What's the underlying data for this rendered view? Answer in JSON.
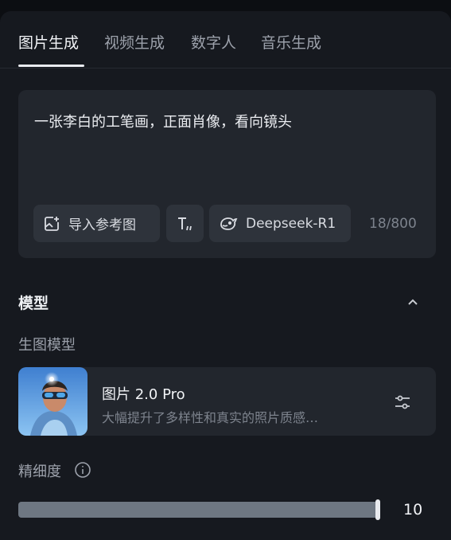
{
  "tabs": [
    {
      "label": "图片生成",
      "active": true
    },
    {
      "label": "视频生成",
      "active": false
    },
    {
      "label": "数字人",
      "active": false
    },
    {
      "label": "音乐生成",
      "active": false
    }
  ],
  "prompt": {
    "text": "一张李白的工笔画，正面肖像，看向镜头",
    "counter": "18/800",
    "chips": {
      "import_ref": {
        "label": "导入参考图",
        "icon": "image-add-icon"
      },
      "text_style": {
        "label": "",
        "icon": "text-format-icon"
      },
      "deepseek": {
        "label": "Deepseek-R1",
        "icon": "deepseek-whale-icon"
      }
    }
  },
  "model_section": {
    "title": "模型",
    "collapse_icon": "chevron-up-icon",
    "sub_label": "生图模型",
    "model": {
      "name": "图片 2.0 Pro",
      "description": "大幅提升了多样性和真实的照片质感…",
      "settings_icon": "sliders-icon"
    }
  },
  "detail": {
    "label": "精细度",
    "info_icon": "info-icon",
    "value": "10",
    "level": 1.0
  },
  "colors": {
    "background": "#16191f",
    "card": "#22262d",
    "chip": "#2e333b",
    "slider_fill": "#6e7782"
  }
}
